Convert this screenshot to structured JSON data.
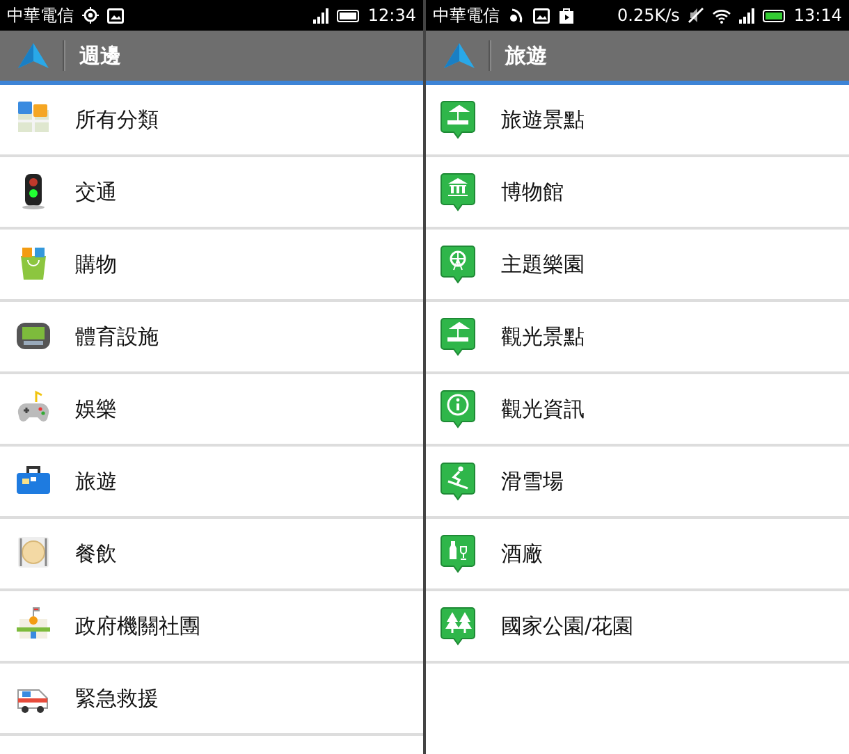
{
  "screens": [
    {
      "status_bar": {
        "carrier": "中華電信",
        "charging": false,
        "time": "12:34"
      },
      "header": {
        "title": "週邊"
      },
      "items": [
        {
          "label": "所有分類"
        },
        {
          "label": "交通"
        },
        {
          "label": "購物"
        },
        {
          "label": "體育設施"
        },
        {
          "label": "娛樂"
        },
        {
          "label": "旅遊"
        },
        {
          "label": "餐飲"
        },
        {
          "label": "政府機關社團"
        },
        {
          "label": "緊急救援"
        }
      ]
    },
    {
      "status_bar": {
        "carrier": "中華電信",
        "speed": "0.25K/s",
        "charging": true,
        "time": "13:14"
      },
      "header": {
        "title": "旅遊"
      },
      "items": [
        {
          "label": "旅遊景點"
        },
        {
          "label": "博物館"
        },
        {
          "label": "主題樂園"
        },
        {
          "label": "觀光景點"
        },
        {
          "label": "觀光資訊"
        },
        {
          "label": "滑雪場"
        },
        {
          "label": "酒廠"
        },
        {
          "label": "國家公園/花園"
        }
      ]
    }
  ]
}
